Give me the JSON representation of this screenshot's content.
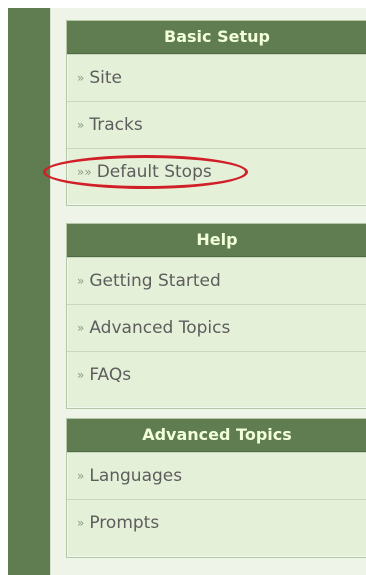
{
  "sidebar": {
    "sections": [
      {
        "title": "Basic Setup",
        "items": [
          {
            "prefix": "»",
            "label": "Site"
          },
          {
            "prefix": "»",
            "label": "Tracks"
          },
          {
            "prefix": "»»",
            "label": "Default Stops"
          }
        ]
      },
      {
        "title": "Help",
        "items": [
          {
            "prefix": "»",
            "label": "Getting Started"
          },
          {
            "prefix": "»",
            "label": "Advanced Topics"
          },
          {
            "prefix": "»",
            "label": "FAQs"
          }
        ]
      },
      {
        "title": "Advanced Topics",
        "items": [
          {
            "prefix": "»",
            "label": "Languages"
          },
          {
            "prefix": "»",
            "label": "Prompts"
          }
        ]
      }
    ]
  },
  "colors": {
    "header_green": "#5f7d51",
    "menu_bg": "#e5f0d9",
    "highlight_red": "#d11f28"
  }
}
